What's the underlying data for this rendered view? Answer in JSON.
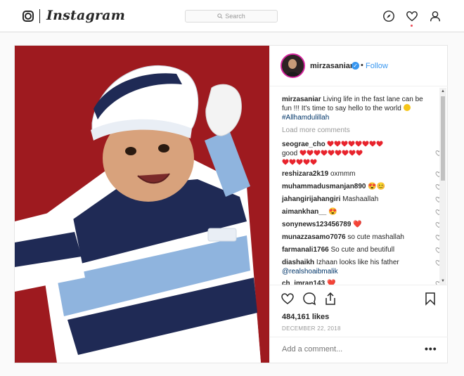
{
  "app": {
    "name": "Instagram"
  },
  "search": {
    "placeholder": "Search"
  },
  "icons": {
    "explore": "compass-icon",
    "activity": "heart-icon",
    "profile": "person-icon"
  },
  "post": {
    "username": "mirzasaniar",
    "follow_label": "Follow",
    "separator": "•",
    "caption": {
      "username": "mirzasaniar",
      "text": "Living life in the fast lane can be fun !!! It's time to say hello to the world",
      "hashtag": "#Allhamdulillah"
    },
    "load_more": "Load more comments",
    "comments": [
      {
        "user": "seograe_cho",
        "text": "good",
        "hearts_before": 8,
        "hearts_after": 17,
        "layout": "hearts"
      },
      {
        "user": "reshizara2k19",
        "text": "oxmmm"
      },
      {
        "user": "muhammadusmanjan890",
        "text": "😍😊"
      },
      {
        "user": "jahangirijahangiri",
        "text": "Mashaallah"
      },
      {
        "user": "aimankhan__",
        "text": "😍"
      },
      {
        "user": "sonynews123456789",
        "text": "❤️"
      },
      {
        "user": "munazzasamo7076",
        "text": "so cute mashallah"
      },
      {
        "user": "farmanali1766",
        "text": "So cute and beutifull"
      },
      {
        "user": "diashaikh",
        "text": "Izhaan looks like his father",
        "mention": "@realshoaibmalik"
      },
      {
        "user": "ch_imran143",
        "text": "❤️"
      }
    ],
    "likes": "484,161 likes",
    "date": "DECEMBER 22, 2018",
    "add_comment_placeholder": "Add a comment...",
    "more_options": "•••"
  },
  "colors": {
    "accent": "#3897f0",
    "heart_red": "#ed4956",
    "text": "#262626",
    "muted": "#999999"
  }
}
